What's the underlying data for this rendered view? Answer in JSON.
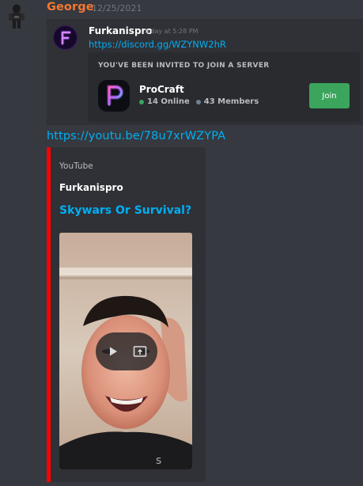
{
  "message": {
    "author": "George",
    "timestamp": "12/25/2021",
    "author_color": "#f57731"
  },
  "quoted": {
    "author": "Furkanispro",
    "time": "Today at 5:28 PM",
    "link": "https://discord.gg/WZYNW2hR",
    "avatar_icon": "neon-f-logo-icon"
  },
  "invite": {
    "heading": "YOU'VE BEEN INVITED TO JOIN A SERVER",
    "server_name": "ProCraft",
    "online": "14 Online",
    "members": "43 Members",
    "join_label": "Join",
    "server_icon": "neon-p-logo-icon",
    "online_color": "#3ba55d",
    "button_color": "#3ba55d"
  },
  "youtube": {
    "link": "https://youtu.be/78u7xrWZYPA",
    "embed": {
      "provider": "YouTube",
      "author": "Furkanispro",
      "title": "Skywars Or Survival?",
      "accent_color": "#ff0000",
      "play_icon": "play-icon",
      "open_icon": "open-external-icon"
    }
  },
  "colors": {
    "background": "#36393f",
    "link": "#00aff4",
    "embed_background": "#2f3136"
  }
}
